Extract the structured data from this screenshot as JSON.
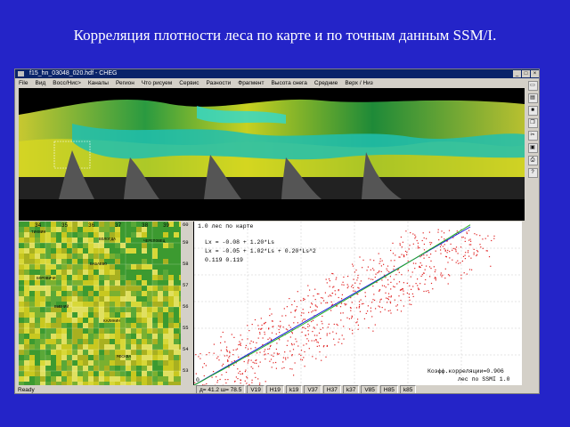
{
  "slide": {
    "title": "Корреляция плотности леса по карте и по точным данным SSM/I."
  },
  "window": {
    "title": "f15_hn_03048_020.hdf - CHEG",
    "buttons": [
      "_",
      "□",
      "×"
    ],
    "menu": [
      "File",
      "Вид",
      "Восс/Нис>",
      "Каналы",
      "Регион",
      "Что рисуем",
      "Сервис",
      "Разности",
      "Фрагмент",
      "Высота снега",
      "Средние",
      "Верх / Низ"
    ],
    "toolbar_icons": [
      "new-file-icon",
      "open-file-icon",
      "save-icon",
      "copy-icon",
      "cut-icon",
      "paste-icon",
      "print-icon",
      "help-icon"
    ]
  },
  "map_grid": {
    "top_labels": [
      "34",
      "35",
      "36",
      "37",
      "38",
      "39"
    ],
    "right_labels": [
      "60",
      "59",
      "58",
      "57",
      "56",
      "55",
      "54",
      "53"
    ],
    "towns": [
      "ТИХВИН",
      "ВОЛОГДА",
      "БАБАЕВО",
      "ЧЕРЕПОВЕЦ",
      "БОРОВИЧИ",
      "ВЫШНИЙ",
      "КАЛИНИН",
      "МОСКВА"
    ]
  },
  "scatter": {
    "title": "1.0 лес по карте",
    "eq1": "Lx = -0.08 + 1.20*Ls",
    "eq2": "Lx = -0.05 + 1.02*Ls + 0.20*Ls^2",
    "eq3": "0.119   0.119",
    "corr": "Коэфф.корреляции=0.906",
    "xlabel": "лес по SSMI 1.0",
    "origin": "0",
    "fit_colors": {
      "linear": "#1a1ae0",
      "quadratic": "#20b020",
      "points": "#e02020"
    }
  },
  "status": {
    "ready": "Ready",
    "cells": [
      "д= 41.2  ш= 78.5",
      "V19",
      "H19",
      "k19",
      "V37",
      "H37",
      "k37",
      "V85",
      "H85",
      "k85"
    ]
  }
}
